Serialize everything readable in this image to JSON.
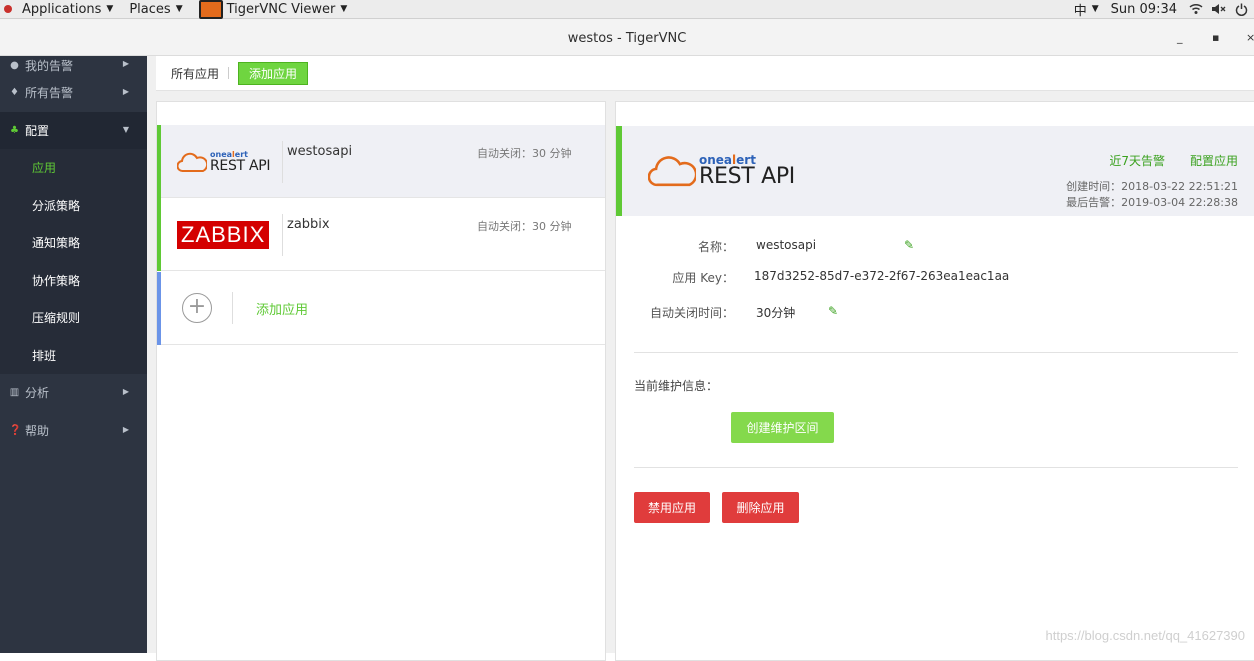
{
  "topbar": {
    "applications": "Applications",
    "places": "Places",
    "app_name": "TigerVNC Viewer",
    "input_method": "中",
    "clock": "Sun 09:34"
  },
  "window": {
    "title": "westos - TigerVNC",
    "minimize": "_",
    "maximize": "▪",
    "close": "×"
  },
  "sidebar": {
    "items": [
      {
        "label": "我的告警",
        "icon": "user-icon"
      },
      {
        "label": "所有告警",
        "icon": "flame-icon"
      },
      {
        "label": "配置",
        "icon": "sitemap-icon"
      },
      {
        "label": "分析",
        "icon": "bar-chart-icon"
      },
      {
        "label": "帮助",
        "icon": "question-icon"
      }
    ],
    "sub_items": [
      "应用",
      "分派策略",
      "通知策略",
      "协作策略",
      "压缩规则",
      "排班"
    ],
    "accent": "#5fc935"
  },
  "tabs": {
    "all_apps": "所有应用",
    "add_app": "添加应用"
  },
  "apps": [
    {
      "name": "westosapi",
      "autoclose": "自动关闭：30 分钟",
      "logo": "onealert-rest-api"
    },
    {
      "name": "zabbix",
      "autoclose": "自动关闭：30 分钟",
      "logo": "zabbix"
    }
  ],
  "logos": {
    "onealert_brand_a": "onea",
    "onealert_brand_b": "l",
    "onealert_brand_c": "ert",
    "rest_api": "REST API",
    "zabbix": "ZABBIX"
  },
  "add_row": {
    "label": "添加应用"
  },
  "detail": {
    "link_recent": "近7天告警",
    "link_config": "配置应用",
    "created": "创建时间：2018-03-22 22:51:21",
    "last_alert": "最后告警：2019-03-04 22:28:38",
    "name_label": "名称：",
    "name_value": "westosapi",
    "key_label": "应用 Key：",
    "key_value": "187d3252-85d7-e372-2f67-263ea1eac1aa",
    "autoclose_label": "自动关闭时间：",
    "autoclose_value": "30分钟",
    "maint_label": "当前维护信息：",
    "create_maint_btn": "创建维护区间",
    "disable_btn": "禁用应用",
    "delete_btn": "删除应用"
  },
  "watermark": "https://blog.csdn.net/qq_41627390"
}
